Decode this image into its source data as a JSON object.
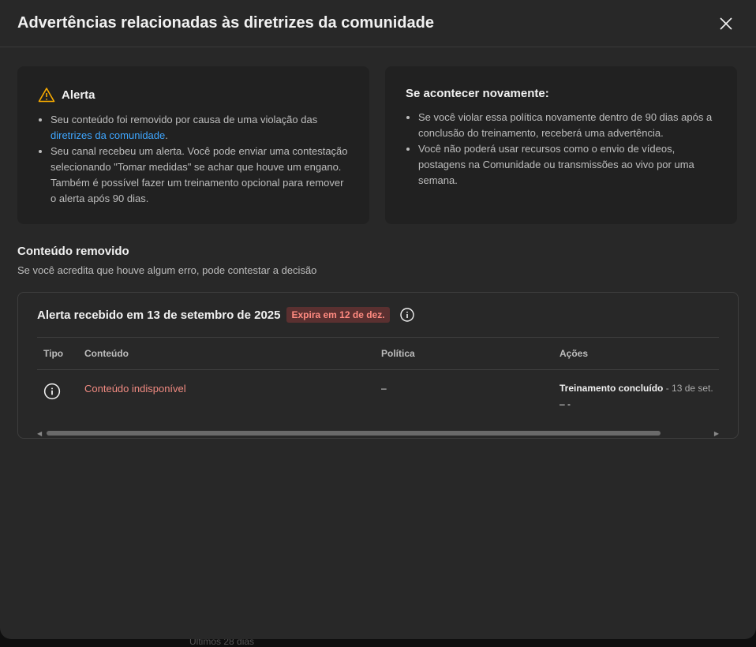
{
  "background_text": "Últimos 28 dias",
  "dialog": {
    "title": "Advertências relacionadas às diretrizes da comunidade",
    "close_icon": "close-icon"
  },
  "alert_card": {
    "title": "Alerta",
    "icon": "warning-icon",
    "bullet1_prefix": "Seu conteúdo foi removido por causa de uma violação das ",
    "bullet1_link": "diretrizes da comunidade",
    "bullet1_suffix": ".",
    "bullet2": "Seu canal recebeu um alerta. Você pode enviar uma contestação selecionando \"Tomar medidas\" se achar que houve um engano. Também é possível fazer um treinamento opcional para remover o alerta após 90 dias."
  },
  "again_card": {
    "title": "Se acontecer novamente:",
    "bullet1": "Se você violar essa política novamente dentro de 90 dias após a conclusão do treinamento, receberá uma advertência.",
    "bullet2": "Você não poderá usar recursos como o envio de vídeos, postagens na Comunidade ou transmissões ao vivo por uma semana."
  },
  "removed": {
    "title": "Conteúdo removido",
    "subtitle": "Se você acredita que houve algum erro, pode contestar a decisão"
  },
  "strike": {
    "title": "Alerta recebido em 13 de setembro de 2025",
    "badge": "Expira em 12 de dez.",
    "columns": [
      "Tipo",
      "Conteúdo",
      "Política",
      "Ações"
    ],
    "row": {
      "content": "Conteúdo indisponível",
      "policy": "–",
      "action": "Treinamento concluído",
      "action_date": " - 13 de set.",
      "action_extra": "– -"
    }
  },
  "colors": {
    "accent_link": "#3ea6ff",
    "badge_text": "#ff8a80",
    "warning": "#f9ab00"
  }
}
